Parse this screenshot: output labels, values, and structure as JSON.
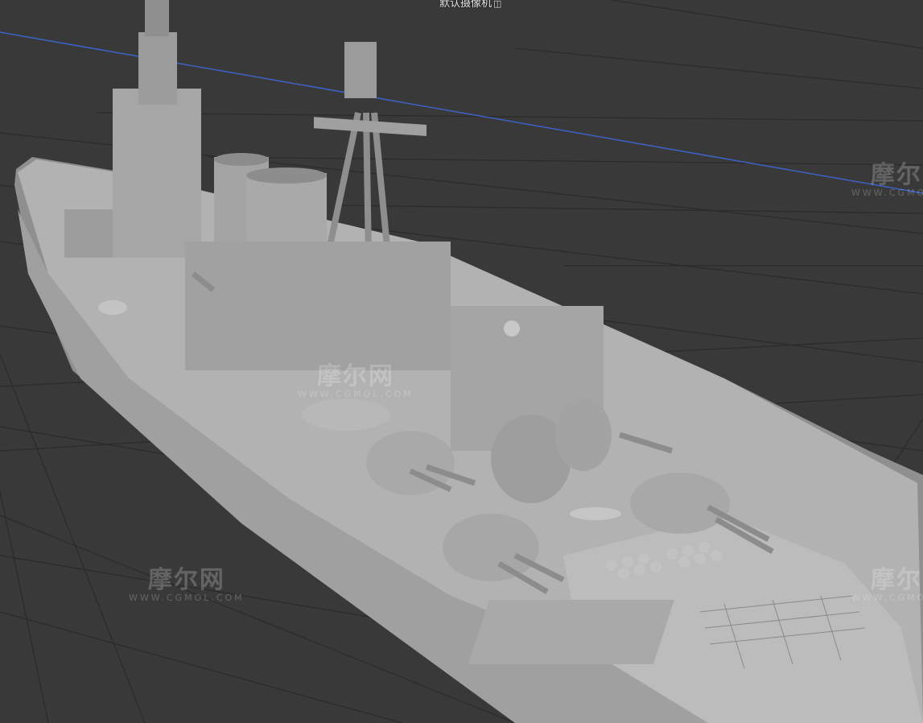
{
  "viewport": {
    "camera_label": "默认摄像机",
    "camera_icon": "camera-icon"
  },
  "watermarks": [
    {
      "text": "摩尔网",
      "sub": "WWW.CGMOL.COM"
    },
    {
      "text": "摩尔网",
      "sub": "WWW.CGMOL.COM"
    },
    {
      "text": "摩尔网",
      "sub": "WWW.CGMOL.COM"
    },
    {
      "text": "摩尔网",
      "sub": "WWW.CGMOL.COM"
    }
  ],
  "colors": {
    "background": "#393939",
    "grid": "#2a2a2a",
    "axis": "#3d63c8",
    "hull": "#9a9a9a",
    "deck": "#b4b4b4",
    "superstructure": "#a8a8a8"
  }
}
